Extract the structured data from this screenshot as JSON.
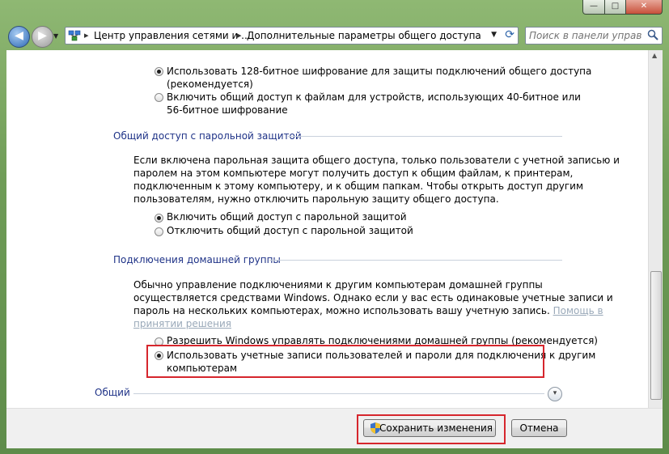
{
  "window": {
    "minimize_label": "—",
    "maximize_label": "□",
    "close_label": "✕"
  },
  "navigation": {
    "breadcrumbs": [
      "Центр управления сетями и ...",
      "Дополнительные параметры общего доступа"
    ],
    "search_placeholder": "Поиск в панели управ..."
  },
  "encryption": {
    "options": [
      {
        "label": "Использовать 128-битное шифрование для защиты подключений общего доступа (рекомендуется)",
        "line1": "Использовать 128-битное шифрование для защиты подключений общего доступа",
        "line2": "(рекомендуется)",
        "selected": true
      },
      {
        "label": "Включить общий доступ к файлам для устройств, использующих 40-битное или 56-битное шифрование",
        "line1": "Включить общий доступ к файлам для устройств, использующих 40-битное или",
        "line2": "56-битное шифрование",
        "selected": false
      }
    ]
  },
  "password_sharing": {
    "title": "Общий доступ с парольной защитой",
    "description": [
      "Если включена парольная защита общего доступа, только пользователи с учетной записью и",
      "паролем на этом компьютере могут получить доступ к общим файлам, к принтерам,",
      "подключенным к этому компьютеру, и к общим папкам. Чтобы открыть доступ другим",
      "пользователям, нужно отключить парольную защиту общего доступа."
    ],
    "options": [
      {
        "label": "Включить общий доступ с парольной защитой",
        "selected": true
      },
      {
        "label": "Отключить общий доступ с парольной защитой",
        "selected": false
      }
    ]
  },
  "homegroup": {
    "title": "Подключения домашней группы",
    "description": [
      "Обычно управление подключениями к другим компьютерам домашней группы",
      "осуществляется средствами Windows. Однако если у вас есть одинаковые учетные записи и",
      "пароль на нескольких компьютерах, можно использовать вашу учетную запись."
    ],
    "help_link_part1": "Помощь в",
    "help_link_part2": "принятии решения",
    "options": [
      {
        "label": "Разрешить Windows управлять подключениями домашней группы (рекомендуется)",
        "selected": false
      },
      {
        "label": "Использовать учетные записи пользователей и пароли для подключения к другим компьютерам",
        "line1": "Использовать учетные записи пользователей и пароли для подключения к другим",
        "line2": "компьютерам",
        "selected": true
      }
    ]
  },
  "general_section": {
    "title": "Общий"
  },
  "buttons": {
    "save": "Сохранить изменения",
    "cancel": "Отмена"
  },
  "colors": {
    "highlight": "#d6262d",
    "section_title": "#1e3287"
  }
}
